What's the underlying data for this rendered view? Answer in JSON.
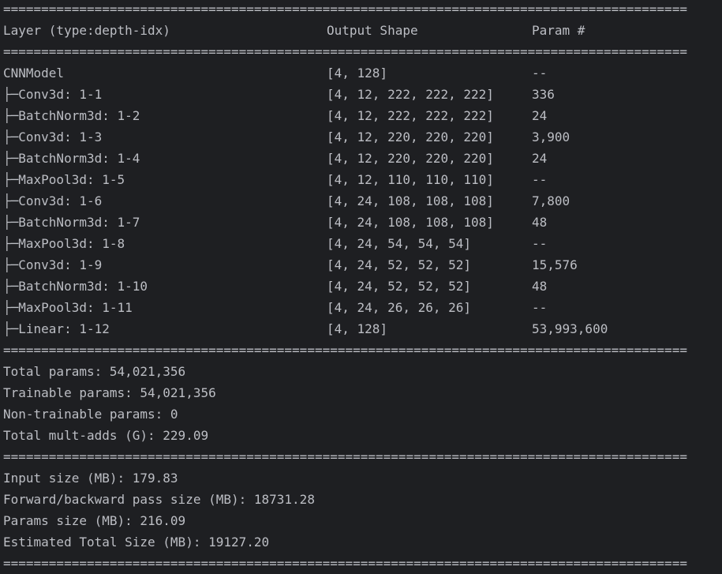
{
  "separator": "==========================================================================================",
  "header": {
    "layer": "Layer (type:depth-idx)",
    "output": "Output Shape",
    "params": "Param #"
  },
  "rows": [
    {
      "layer": "CNNModel",
      "output": "[4, 128]",
      "params": "--"
    },
    {
      "layer": "├─Conv3d: 1-1",
      "output": "[4, 12, 222, 222, 222]",
      "params": "336"
    },
    {
      "layer": "├─BatchNorm3d: 1-2",
      "output": "[4, 12, 222, 222, 222]",
      "params": "24"
    },
    {
      "layer": "├─Conv3d: 1-3",
      "output": "[4, 12, 220, 220, 220]",
      "params": "3,900"
    },
    {
      "layer": "├─BatchNorm3d: 1-4",
      "output": "[4, 12, 220, 220, 220]",
      "params": "24"
    },
    {
      "layer": "├─MaxPool3d: 1-5",
      "output": "[4, 12, 110, 110, 110]",
      "params": "--"
    },
    {
      "layer": "├─Conv3d: 1-6",
      "output": "[4, 24, 108, 108, 108]",
      "params": "7,800"
    },
    {
      "layer": "├─BatchNorm3d: 1-7",
      "output": "[4, 24, 108, 108, 108]",
      "params": "48"
    },
    {
      "layer": "├─MaxPool3d: 1-8",
      "output": "[4, 24, 54, 54, 54]",
      "params": "--"
    },
    {
      "layer": "├─Conv3d: 1-9",
      "output": "[4, 24, 52, 52, 52]",
      "params": "15,576"
    },
    {
      "layer": "├─BatchNorm3d: 1-10",
      "output": "[4, 24, 52, 52, 52]",
      "params": "48"
    },
    {
      "layer": "├─MaxPool3d: 1-11",
      "output": "[4, 24, 26, 26, 26]",
      "params": "--"
    },
    {
      "layer": "├─Linear: 1-12",
      "output": "[4, 128]",
      "params": "53,993,600"
    }
  ],
  "totals": [
    "Total params: 54,021,356",
    "Trainable params: 54,021,356",
    "Non-trainable params: 0",
    "Total mult-adds (G): 229.09"
  ],
  "sizes": [
    "Input size (MB): 179.83",
    "Forward/backward pass size (MB): 18731.28",
    "Params size (MB): 216.09",
    "Estimated Total Size (MB): 19127.20"
  ]
}
